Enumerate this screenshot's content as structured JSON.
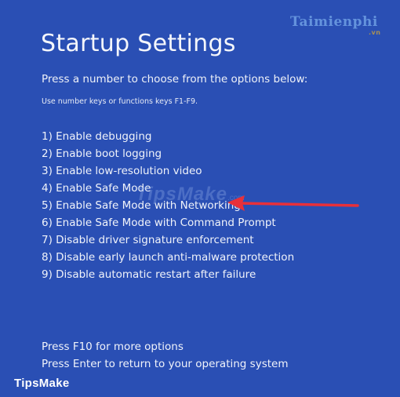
{
  "screen": {
    "title": "Startup Settings",
    "subtitle": "Press a number to choose from the options below:",
    "hint": "Use number keys or functions keys F1-F9.",
    "options": [
      "1) Enable debugging",
      "2) Enable boot logging",
      "3) Enable low-resolution video",
      "4) Enable Safe Mode",
      "5) Enable Safe Mode with Networking",
      "6) Enable Safe Mode with Command Prompt",
      "7) Disable driver signature enforcement",
      "8) Disable early launch anti-malware protection",
      "9) Disable automatic restart after failure"
    ],
    "footer_more": "Press F10 for more options",
    "footer_return": "Press Enter to return to your operating system"
  },
  "annotation": {
    "arrow_color": "#e8303a",
    "arrow_points_to_option": "5) Enable Safe Mode with Networking"
  },
  "watermarks": {
    "top_right": "Taimienphi",
    "top_right_suffix": ".vn",
    "center": "TipsMake",
    "center_suffix": ".com"
  },
  "brand_bar": {
    "label": "TipsMake"
  },
  "colors": {
    "background": "#2a4fb4",
    "text": "#ffffff"
  }
}
